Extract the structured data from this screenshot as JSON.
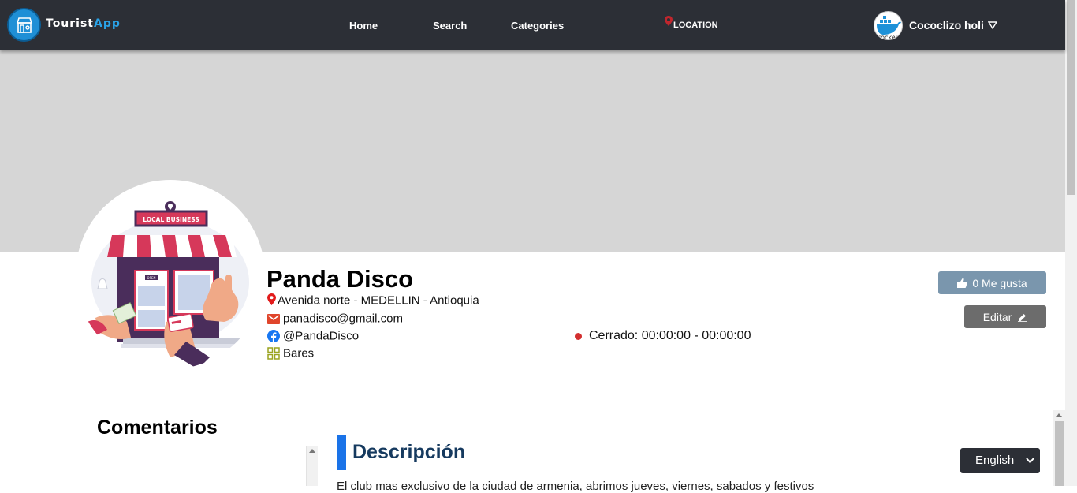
{
  "navbar": {
    "brand_main": "Tourist",
    "brand_accent": "App",
    "links": {
      "home": "Home",
      "search": "Search",
      "categories": "Categories"
    },
    "location_label": "LOCATION",
    "user_name": "Cococlizo holi"
  },
  "business": {
    "name": "Panda Disco",
    "address": "Avenida norte - MEDELLIN - Antioquia",
    "email": "panadisco@gmail.com",
    "facebook": "@PandaDisco",
    "category": "Bares",
    "status": "Cerrado: 00:00:00 - 00:00:00",
    "logo_sign": "LOCAL BUSINESS",
    "logo_door_sign": "OPEN"
  },
  "actions": {
    "like_label": "0 Me gusta",
    "edit_label": "Editar"
  },
  "sections": {
    "comments_title": "Comentarios",
    "description_title": "Descripción",
    "description_text": "El club mas exclusivo de la ciudad de armenia, abrimos jueves, viernes, sabados y festivos"
  },
  "language": {
    "selected": "English"
  },
  "colors": {
    "navbar": "#2c2f36",
    "accent": "#2aa3e8",
    "cover": "#d6d6d6",
    "like_button": "#7a96ad",
    "edit_button": "#6c6c6c",
    "status_dot": "#d32f2f",
    "description_bar": "#1a73e8",
    "description_title": "#163a5f"
  }
}
